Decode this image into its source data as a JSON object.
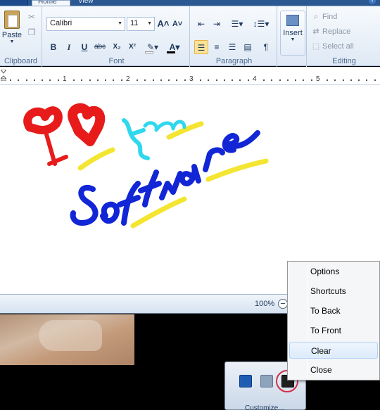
{
  "tabs": {
    "home": "Home",
    "view": "View",
    "help": "?"
  },
  "ribbon": {
    "clipboard": {
      "paste_label": "Paste",
      "group_label": "Clipboard",
      "cut_icon": "cut-icon",
      "copy_icon": "copy-icon"
    },
    "font": {
      "font_name": "Calibri",
      "font_size": "11",
      "group_label": "Font",
      "bold": "B",
      "italic": "I",
      "underline": "U",
      "strike": "abc",
      "subscript": "X₂",
      "superscript": "X²",
      "grow": "A˄",
      "shrink": "A˅",
      "fontcolor": "A",
      "highlight_color": "#ffffff",
      "fontcolor_color": "#000000"
    },
    "paragraph": {
      "group_label": "Paragraph",
      "active_alignment": "left"
    },
    "insert": {
      "label": "Insert"
    },
    "editing": {
      "group_label": "Editing",
      "find": "Find",
      "replace": "Replace",
      "select_all": "Select all"
    }
  },
  "ruler": {
    "labels": [
      "1",
      "2",
      "3",
      "4",
      "5"
    ]
  },
  "drawing": {
    "colors": {
      "red": "#e81b1b",
      "cyan": "#2fd8ec",
      "yellow": "#f4e531",
      "blue": "#1226d6"
    }
  },
  "statusbar": {
    "zoom": "100%",
    "zoom_out": "−"
  },
  "tray": {
    "customize": "Customize..."
  },
  "context_menu": {
    "items": [
      "Options",
      "Shortcuts",
      "To Back",
      "To Front",
      "Clear",
      "Close"
    ],
    "hovered": "Clear"
  }
}
